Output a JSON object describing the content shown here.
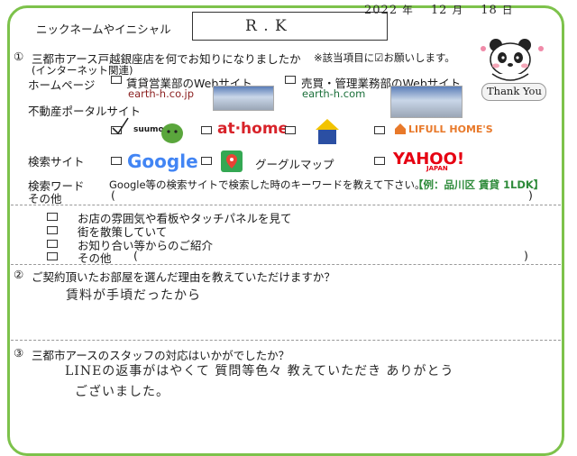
{
  "header": {
    "nickname_label": "ニックネームやイニシャル",
    "nickname_value": "R . K",
    "date": {
      "year": "2022",
      "year_unit": "年",
      "month": "12",
      "month_unit": "月",
      "day": "18",
      "day_unit": "日"
    }
  },
  "q1": {
    "number": "①",
    "title": "三都市アース戸越銀座店を何でお知りになりましたか",
    "note": "※該当項目に☑お願いします。",
    "subtitle": "(インターネット関連)",
    "homepage_label": "ホームページ",
    "site_rental": "賃貸営業部のWebサイト",
    "site_rental_url": "earth-h.co.jp",
    "site_sales": "売買・管理業務部のWebサイト",
    "site_sales_url": "earth-h.com",
    "portal_label": "不動産ポータルサイト",
    "suumo": "suumo",
    "athome": "at·home",
    "lifull": "LIFULL HOME'S",
    "search_label": "検索サイト",
    "google": "Google",
    "googlemap": "グーグルマップ",
    "yahoo": "YAHOO!",
    "yahoo_sub": "JAPAN",
    "keyword_label": "検索ワード",
    "keyword_text": "Google等の検索サイトで検索した時のキーワードを教えて下さい。",
    "keyword_example": "【例：品川区 賃貸 1LDK】",
    "other_label": "その他",
    "paren_open": "(",
    "paren_close": ")",
    "offline": [
      "お店の雰囲気や看板やタッチパネルを見て",
      "街を散策していて",
      "お知り合い等からのご紹介",
      "その他"
    ]
  },
  "q2": {
    "number": "②",
    "title": "ご契約頂いたお部屋を選んだ理由を教えていただけますか？",
    "answer": "賃料が手頃だったから"
  },
  "q3": {
    "number": "③",
    "title": "三都市アースのスタッフの対応はいかがでしたか？",
    "answer_line1": "LINEの返事がはやくて 質問等色々 教えていただき ありがとう",
    "answer_line2": "ございました。"
  },
  "mascot": {
    "thank_you": "Thank You"
  },
  "colors": {
    "border": "#7dc24b",
    "accent_red": "#c0282e",
    "example": "#2e8b3a"
  }
}
